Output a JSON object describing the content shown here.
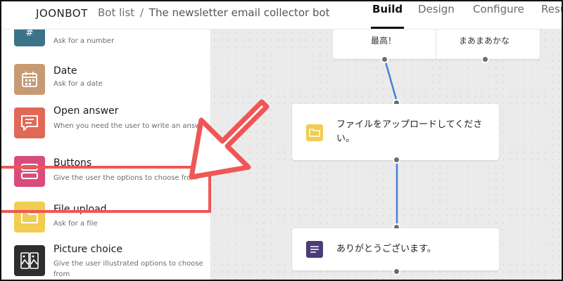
{
  "header": {
    "brand": "JOONBOT",
    "breadcrumb_root": "Bot list",
    "breadcrumb_separator": "/",
    "breadcrumb_current": "The newsletter email collector bot",
    "tabs": [
      {
        "label": "Build",
        "active": true
      },
      {
        "label": "Design",
        "active": false
      },
      {
        "label": "Configure",
        "active": false
      },
      {
        "label": "Resu",
        "active": false
      }
    ]
  },
  "sidebar": {
    "blocks": [
      {
        "title": "",
        "desc": "Ask for a number",
        "icon": "number-icon",
        "color": "#3d7388"
      },
      {
        "title": "Date",
        "desc": "Ask for a date",
        "icon": "calendar-icon",
        "color": "#c79a74"
      },
      {
        "title": "Open answer",
        "desc": "When you need the user to write an answer",
        "icon": "speech-bubble-icon",
        "color": "#e06a57"
      },
      {
        "title": "Buttons",
        "desc": "Give the user the options to choose from",
        "icon": "buttons-icon",
        "color": "#d94d7d"
      },
      {
        "title": "File upload",
        "desc": "Ask for a file",
        "icon": "folder-icon",
        "color": "#f0cd53"
      },
      {
        "title": "Picture choice",
        "desc": "Give the user illustrated options to choose from",
        "icon": "picture-icon",
        "color": "#2d2d2d"
      }
    ]
  },
  "canvas": {
    "options": [
      "最高！",
      "まあまあかな"
    ],
    "file_card_text": "ファイルをアップロードしてください。",
    "thanks_card_text": "ありがとうございます。",
    "connector_color": "#4a7fd4"
  },
  "annotation": {
    "highlight_color": "#ef5656"
  }
}
